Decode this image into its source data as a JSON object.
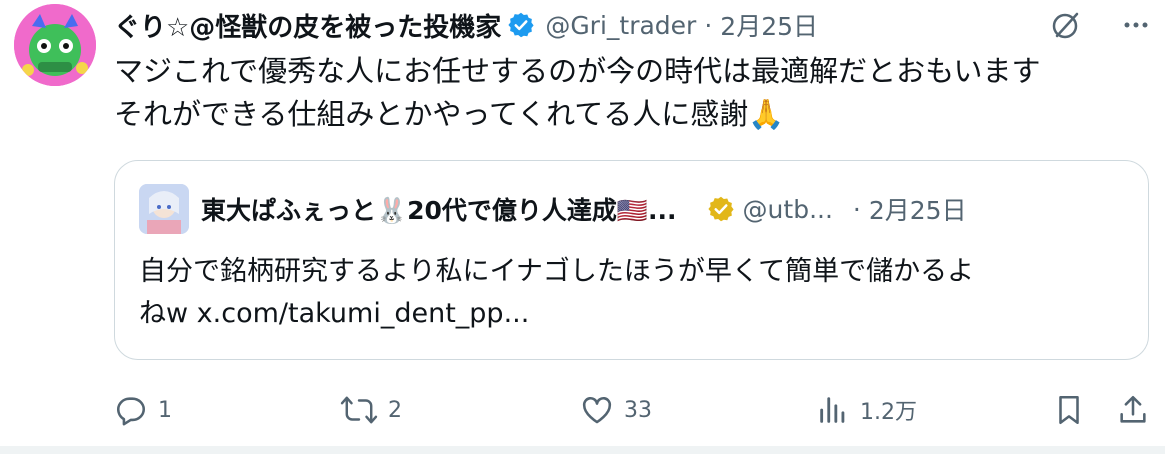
{
  "tweet": {
    "author_name": "ぐり☆@怪獣の皮を被った投機家",
    "handle": "@Gri_trader",
    "separator": "·",
    "date": "2月25日",
    "text_line1": "マジこれで優秀な人にお任せするのが今の時代は最適解だとおもいます",
    "text_line2": "それができる仕組みとかやってくれてる人に感謝🙏"
  },
  "quote": {
    "author_name": "東大ぱふぇっと🐰20代で億り人達成🇺🇸...",
    "handle": "@utb...",
    "separator": "·",
    "date": "2月25日",
    "text_line1": "自分で銘柄研究するより私にイナゴしたほうが早くて簡単で儲かるよ",
    "text_line2": "ねw x.com/takumi_dent_pp..."
  },
  "actions": {
    "reply_count": "1",
    "retweet_count": "2",
    "like_count": "33",
    "views_count": "1.2万"
  },
  "colors": {
    "text": "#0f1419",
    "secondary": "#536471",
    "verified_blue": "#1d9bf0",
    "verified_gold": "#e2b719",
    "border": "#cfd9de"
  },
  "icons": [
    "verified-badge-icon",
    "grok-icon",
    "more-icon",
    "reply-icon",
    "retweet-icon",
    "like-icon",
    "views-icon",
    "bookmark-icon",
    "share-icon"
  ]
}
